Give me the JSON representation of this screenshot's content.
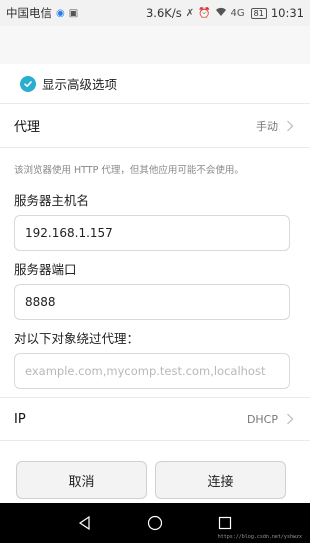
{
  "status_bar": {
    "carrier": "中国电信",
    "net_speed": "3.6K/s",
    "signal_text": "4G",
    "battery": "81",
    "time": "10:31"
  },
  "title_bar": {
    "title": ""
  },
  "advanced": {
    "label": "显示高级选项",
    "checked": true
  },
  "proxy": {
    "label": "代理",
    "value": "手动"
  },
  "hint": "该浏览器使用 HTTP 代理，但其他应用可能不会使用。",
  "host": {
    "label": "服务器主机名",
    "value": "192.168.1.157"
  },
  "port": {
    "label": "服务器端口",
    "value": "8888"
  },
  "bypass": {
    "label": "对以下对象绕过代理：",
    "placeholder": "example.com,mycomp.test.com,localhost"
  },
  "ip": {
    "label": "IP",
    "value": "DHCP"
  },
  "buttons": {
    "cancel": "取消",
    "connect": "连接"
  },
  "watermark": "https://blog.csdn.net/yshwzx",
  "colors": {
    "accent": "#2aaed0",
    "nav_bg": "#000000"
  }
}
